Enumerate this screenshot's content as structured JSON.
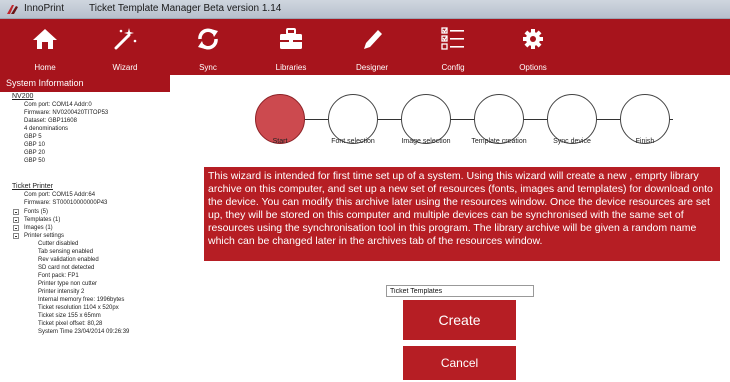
{
  "window": {
    "app_name": "InnoPrint",
    "title": "Ticket Template Manager Beta version 1.14"
  },
  "toolbar": {
    "items": [
      {
        "label": "Home",
        "icon": "home-icon"
      },
      {
        "label": "Wizard",
        "icon": "wand-icon"
      },
      {
        "label": "Sync",
        "icon": "sync-icon"
      },
      {
        "label": "Libraries",
        "icon": "briefcase-icon"
      },
      {
        "label": "Designer",
        "icon": "pen-icon"
      },
      {
        "label": "Config",
        "icon": "checklist-icon"
      },
      {
        "label": "Options",
        "icon": "gear-icon"
      }
    ]
  },
  "system_info": {
    "header": "System Information",
    "device": {
      "name": "NV200",
      "lines": [
        "Com port: COM14 Addr:0",
        "Firmware: NV0200420TITOP53",
        "Dataset: GBP11608",
        "4 denominations",
        "GBP 5",
        "GBP 10",
        "GBP 20",
        "GBP 50"
      ]
    },
    "printer": {
      "name": "Ticket Printer",
      "lines": [
        "Com port: COM15 Addr:64",
        "Firmware: ST00010000000P43"
      ],
      "tree": [
        "Fonts (5)",
        "Templates (1)",
        "Images (1)",
        "Printer settings"
      ],
      "settings": [
        "Cutter disabled",
        "Tab sensing enabled",
        "Rev validation enabled",
        "SD card not detected",
        "Font pack: FP1",
        "Printer type non cutter",
        "Printer intensity 2",
        "Internal memory free: 1996bytes",
        "Ticket resolution 1104 x 520px",
        "Ticket size 155 x 65mm",
        "Ticket pixel offset: 80,28",
        "System Time 23/04/2014 09:26:39"
      ]
    }
  },
  "wizard": {
    "steps": [
      {
        "label": "Start",
        "active": true
      },
      {
        "label": "Font selection",
        "active": false
      },
      {
        "label": "Image selection",
        "active": false
      },
      {
        "label": "Template creation",
        "active": false
      },
      {
        "label": "Sync device",
        "active": false
      },
      {
        "label": "Finish",
        "active": false
      }
    ],
    "info": "This wizard is intended for first time set up of a system. Using this wizard will create a new , emprty library archive on this computer, and set up a new set of resources (fonts, images and templates) for download onto the device. You can modify this archive later using the resources window. Once the device resources are set up, they will be stored on this computer and multiple devices can be synchronised with the same set of resources using the synchronisation tool in this program. The library archive will be given a random name which can be changed later in the archives tab of the resources window.",
    "name_value": "Ticket Templates",
    "create_label": "Create",
    "cancel_label": "Cancel"
  },
  "colors": {
    "accent": "#a7141c",
    "button": "#b61e24",
    "active_step": "#cc4a4f"
  }
}
